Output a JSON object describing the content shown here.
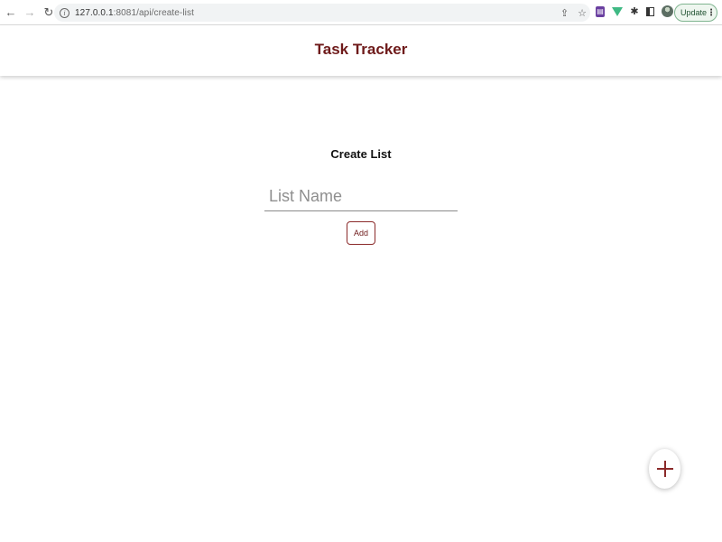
{
  "browser": {
    "url_host": "127.0.0.1",
    "url_rest": ":8081/api/create-list",
    "update_label": "Update",
    "nav_icons": {
      "back": "back-arrow-icon",
      "forward": "forward-arrow-icon",
      "reload": "reload-icon"
    }
  },
  "header": {
    "title": "Task Tracker",
    "title_color": "#6e1a1a"
  },
  "form": {
    "title": "Create List",
    "name_placeholder": "List Name",
    "name_value": "",
    "add_label": "Add"
  },
  "fab": {
    "icon": "plus-icon",
    "color": "#8b2a2a"
  }
}
